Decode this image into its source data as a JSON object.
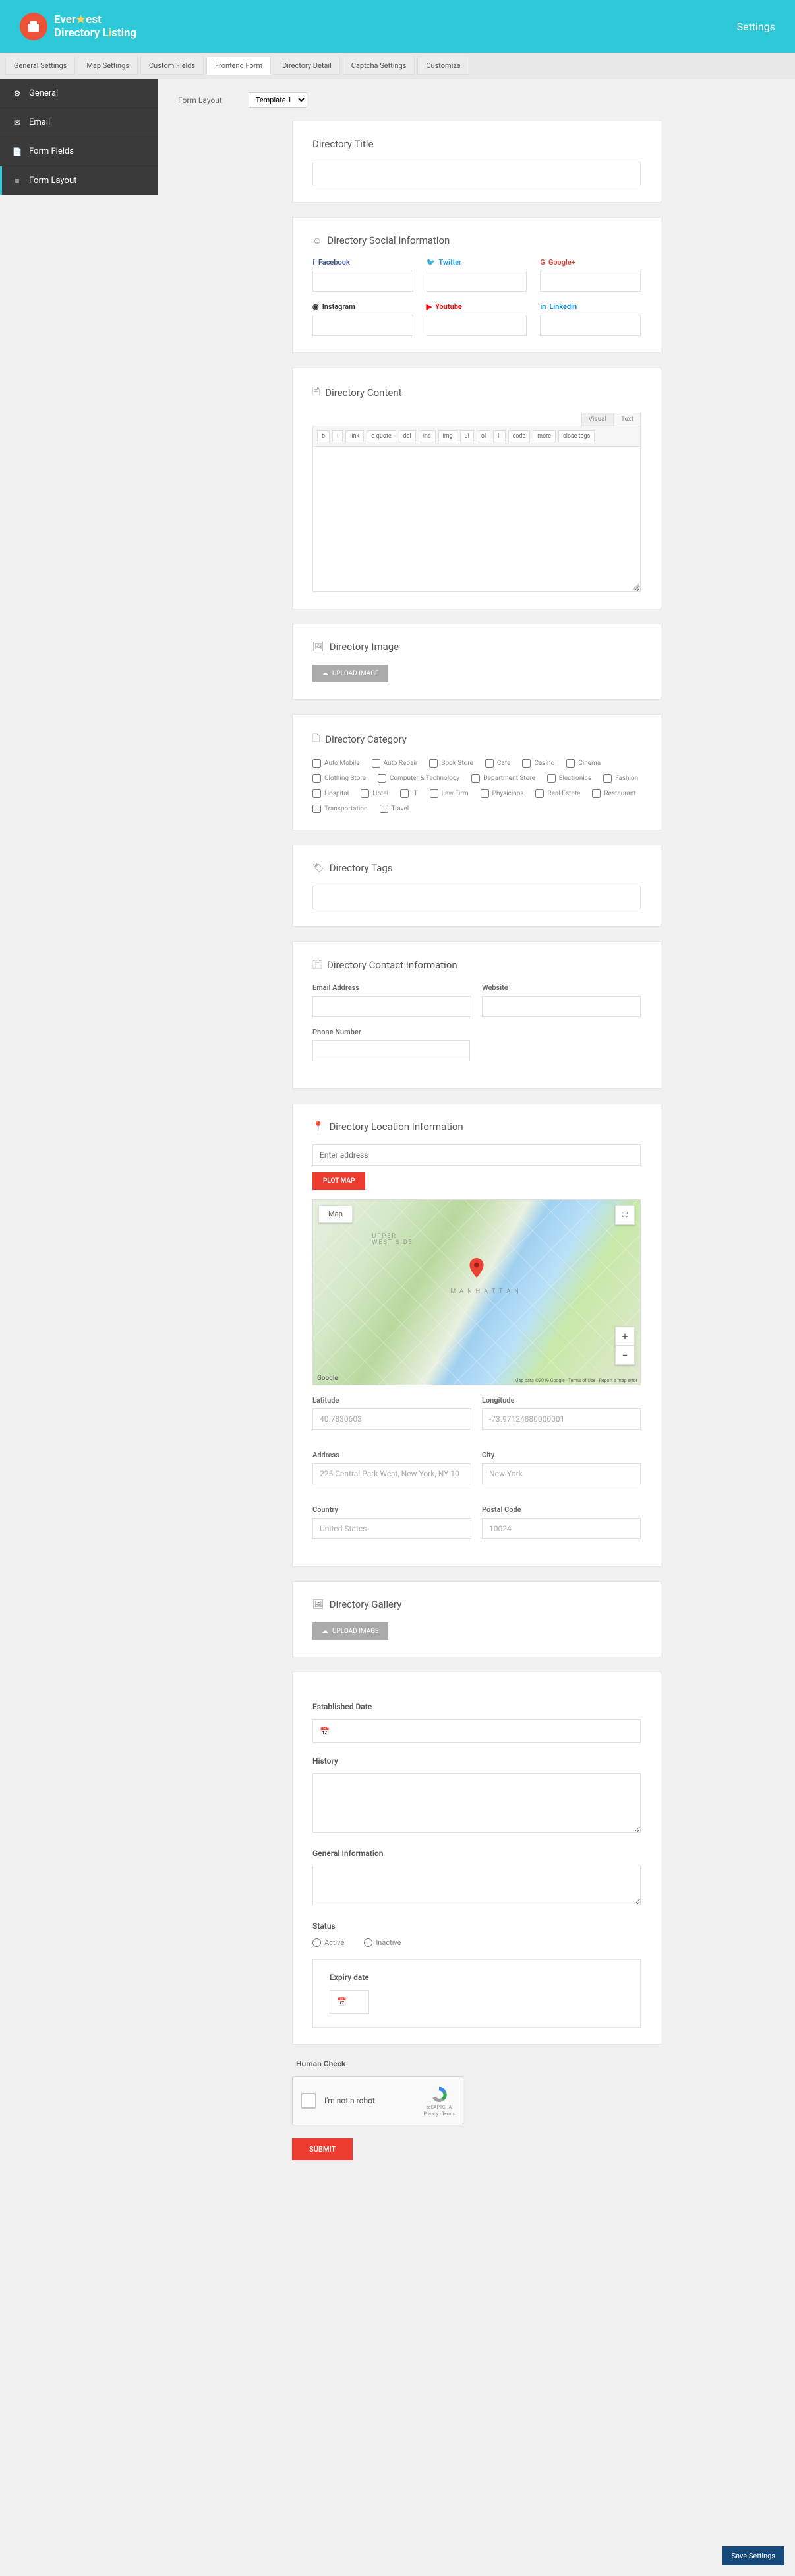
{
  "brand": {
    "line1_a": "Ever",
    "line1_b": "est",
    "line2": "Directory L",
    "line2_accent": "i",
    "line2_end": "sting"
  },
  "topbar": {
    "settings": "Settings"
  },
  "tabs": [
    "General Settings",
    "Map Settings",
    "Custom Fields",
    "Frontend Form",
    "Directory Detail",
    "Captcha Settings",
    "Customize"
  ],
  "tabs_active": 3,
  "sidebar": [
    {
      "icon": "⚙",
      "label": "General"
    },
    {
      "icon": "✉",
      "label": "Email"
    },
    {
      "icon": "📄",
      "label": "Form Fields"
    },
    {
      "icon": "≡",
      "label": "Form Layout"
    }
  ],
  "sidebar_active": 3,
  "toprow": {
    "label": "Form Layout",
    "selected": "Template 1"
  },
  "sec_title": "Directory Title",
  "sec_social": {
    "title": "Directory Social Information",
    "items": [
      {
        "k": "fb",
        "icon": "f",
        "label": "Facebook"
      },
      {
        "k": "tw",
        "icon": "🐦",
        "label": "Twitter"
      },
      {
        "k": "gp",
        "icon": "G",
        "label": "Google+"
      },
      {
        "k": "ig",
        "icon": "◉",
        "label": "Instagram"
      },
      {
        "k": "yt",
        "icon": "▶",
        "label": "Youtube"
      },
      {
        "k": "li",
        "icon": "in",
        "label": "Linkedin"
      }
    ]
  },
  "sec_content": {
    "title": "Directory Content",
    "tabs": [
      "Visual",
      "Text"
    ],
    "toolbar": [
      "b",
      "i",
      "link",
      "b-quote",
      "del",
      "ins",
      "img",
      "ul",
      "ol",
      "li",
      "code",
      "more",
      "close tags"
    ]
  },
  "sec_image": {
    "title": "Directory Image",
    "btn": "UPLOAD IMAGE"
  },
  "sec_category": {
    "title": "Directory Category",
    "items": [
      "Auto Mobile",
      "Auto Repair",
      "Book Store",
      "Cafe",
      "Casino",
      "Cinema",
      "Clothing Store",
      "Computer & Technology",
      "Department Store",
      "Electronics",
      "Fashion",
      "Hospital",
      "Hotel",
      "IT",
      "Law Firm",
      "Physicians",
      "Real Estate",
      "Restaurant",
      "Transportation",
      "Travel"
    ]
  },
  "sec_tags": {
    "title": "Directory Tags"
  },
  "sec_contact": {
    "title": "Directory Contact Information",
    "email": "Email Address",
    "website": "Website",
    "phone": "Phone Number"
  },
  "sec_location": {
    "title": "Directory Location Information",
    "placeholder": "Enter address",
    "plot": "PLOT MAP",
    "map_tab": "Map",
    "labels": {
      "upper": "UPPER\nWEST SIDE",
      "manhattan": "M A N H A T T A N"
    },
    "fields": {
      "lat": {
        "label": "Latitude",
        "value": "40.7830603"
      },
      "lng": {
        "label": "Longitude",
        "value": "-73.97124880000001"
      },
      "addr": {
        "label": "Address",
        "value": "225 Central Park West, New York, NY 10"
      },
      "city": {
        "label": "City",
        "value": "New York"
      },
      "country": {
        "label": "Country",
        "value": "United States"
      },
      "postal": {
        "label": "Postal Code",
        "value": "10024"
      }
    },
    "google": "Google",
    "attr": "Map data ©2019 Google · Terms of Use · Report a map error"
  },
  "sec_gallery": {
    "title": "Directory Gallery",
    "btn": "UPLOAD IMAGE"
  },
  "sec_established": "Established Date",
  "sec_history": "History",
  "sec_general": "General Information",
  "sec_status": {
    "title": "Status",
    "active": "Active",
    "inactive": "Inactive"
  },
  "sec_expiry": "Expiry date",
  "sec_human": {
    "title": "Human Check",
    "captcha": "I'm not a robot",
    "brand": "reCAPTCHA",
    "privacy": "Privacy - Terms"
  },
  "submit": "SUBMIT",
  "save": "Save Settings"
}
